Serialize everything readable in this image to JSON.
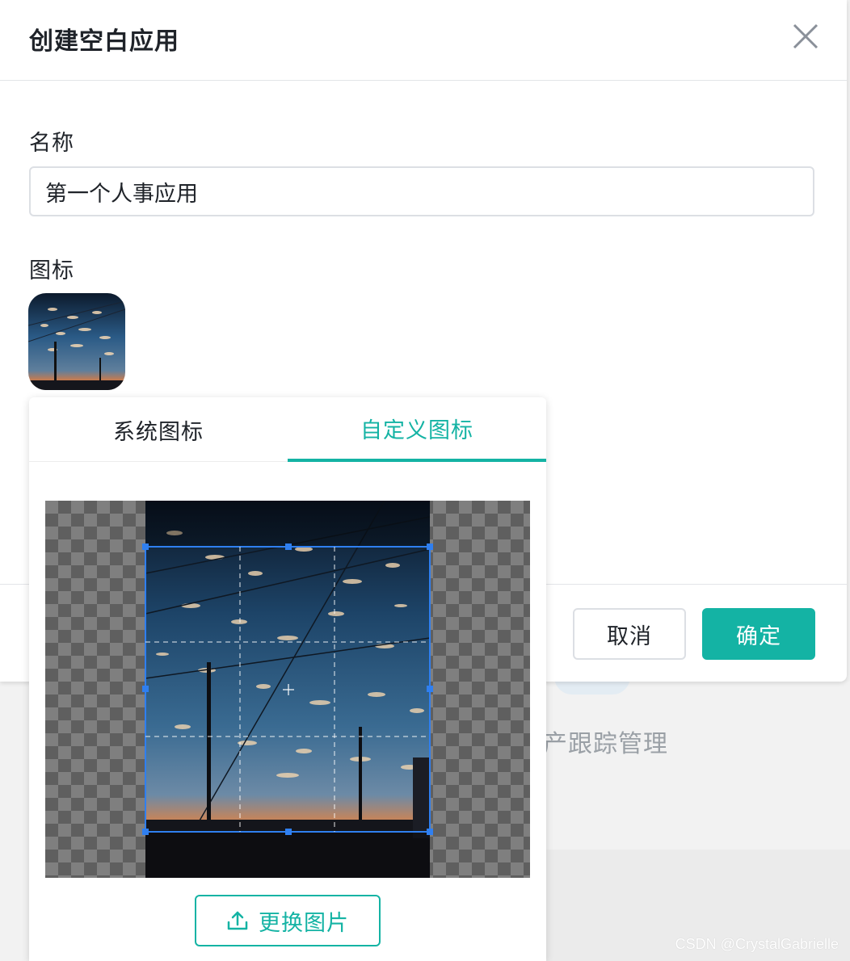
{
  "modal": {
    "title": "创建空白应用",
    "close_icon": "close-icon"
  },
  "form": {
    "name_label": "名称",
    "name_value": "第一个人事应用",
    "icon_label": "图标"
  },
  "icon_picker": {
    "tabs": [
      {
        "label": "系统图标",
        "active": false
      },
      {
        "label": "自定义图标",
        "active": true
      }
    ],
    "replace_label": "更换图片",
    "replace_icon": "upload-icon"
  },
  "footer": {
    "cancel_label": "取消",
    "ok_label": "确定"
  },
  "background": {
    "partial_text": "产跟踪管理"
  },
  "watermark": "CSDN @CrystalGabrielle",
  "colors": {
    "accent": "#14b3a4",
    "text": "#1f2329",
    "crop_border": "#2f7ff0"
  }
}
